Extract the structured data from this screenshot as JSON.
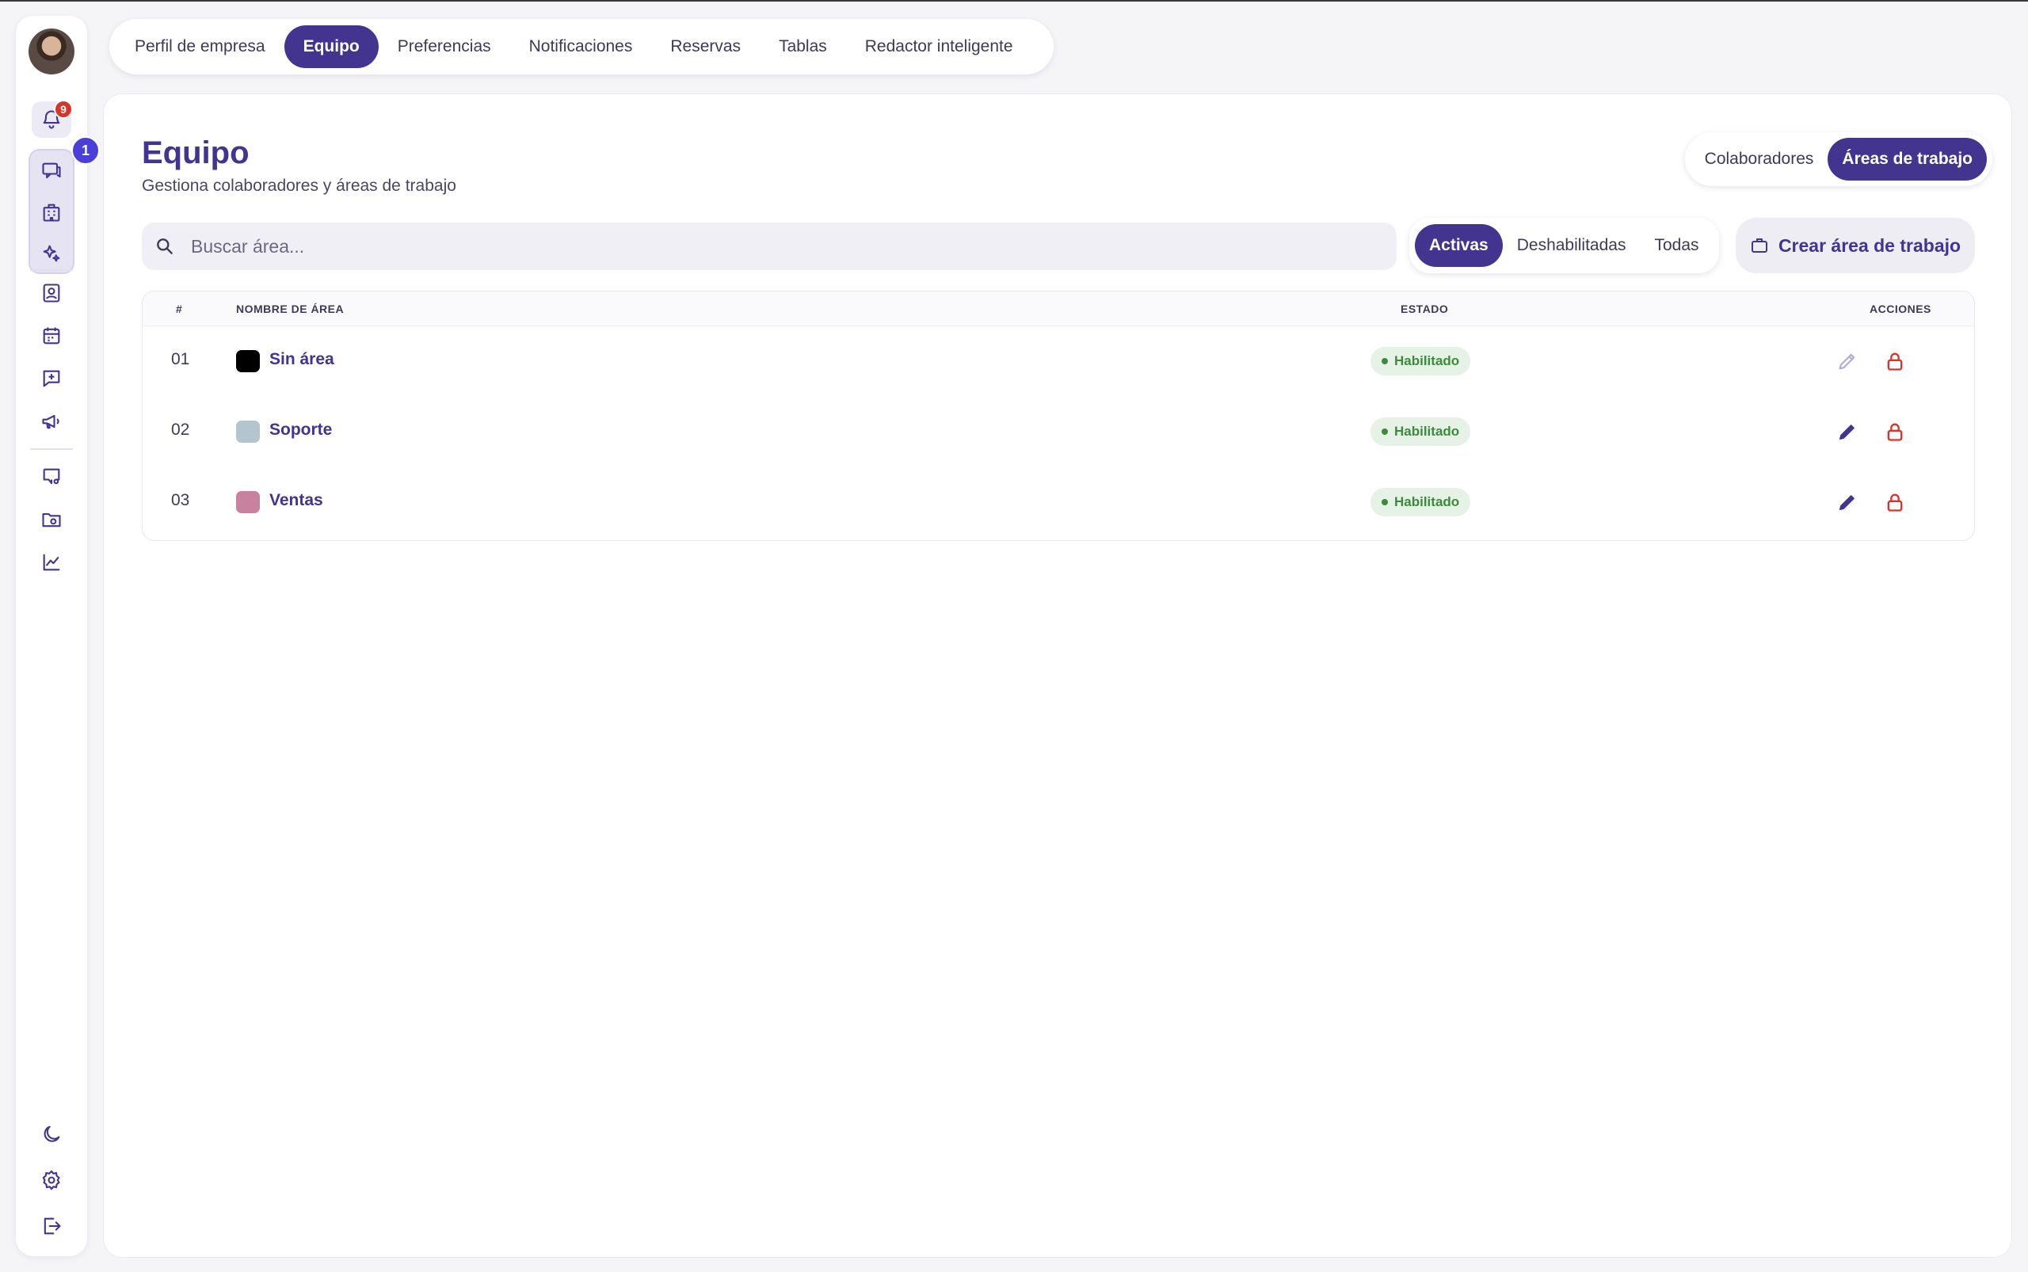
{
  "tabs": [
    "Perfil de empresa",
    "Equipo",
    "Preferencias",
    "Notificaciones",
    "Reservas",
    "Tablas",
    "Redactor inteligente"
  ],
  "sidebar": {
    "notifications_count": "9",
    "messages_count": "1",
    "icons": [
      "bell-icon",
      "chat-icon",
      "building-icon",
      "sparkles-icon",
      "contact-icon",
      "calendar-icon",
      "message-plus-icon",
      "megaphone-icon",
      "monitor-chat-icon",
      "folder-icon",
      "chart-icon",
      "moon-icon",
      "gear-icon",
      "logout-icon"
    ]
  },
  "header": {
    "title": "Equipo",
    "subtitle": "Gestiona colaboradores y áreas de trabajo"
  },
  "view_toggle": [
    "Colaboradores",
    "Áreas de trabajo"
  ],
  "search": {
    "placeholder": "Buscar área..."
  },
  "filters": [
    "Activas",
    "Deshabilitadas",
    "Todas"
  ],
  "create_button": "Crear área de trabajo",
  "table": {
    "columns": [
      "#",
      "NOMBRE DE ÁREA",
      "ESTADO",
      "ACCIONES"
    ],
    "rows": [
      {
        "num": "01",
        "name": "Sin área",
        "status": "Habilitado",
        "color": "#000000"
      },
      {
        "num": "02",
        "name": "Soporte",
        "status": "Habilitado",
        "color": "#b3c5ce"
      },
      {
        "num": "03",
        "name": "Ventas",
        "status": "Habilitado",
        "color": "#c8819f"
      }
    ]
  },
  "colors": {
    "accent": "#43348f",
    "danger": "#d9342b",
    "success": "#3c8a3c"
  }
}
